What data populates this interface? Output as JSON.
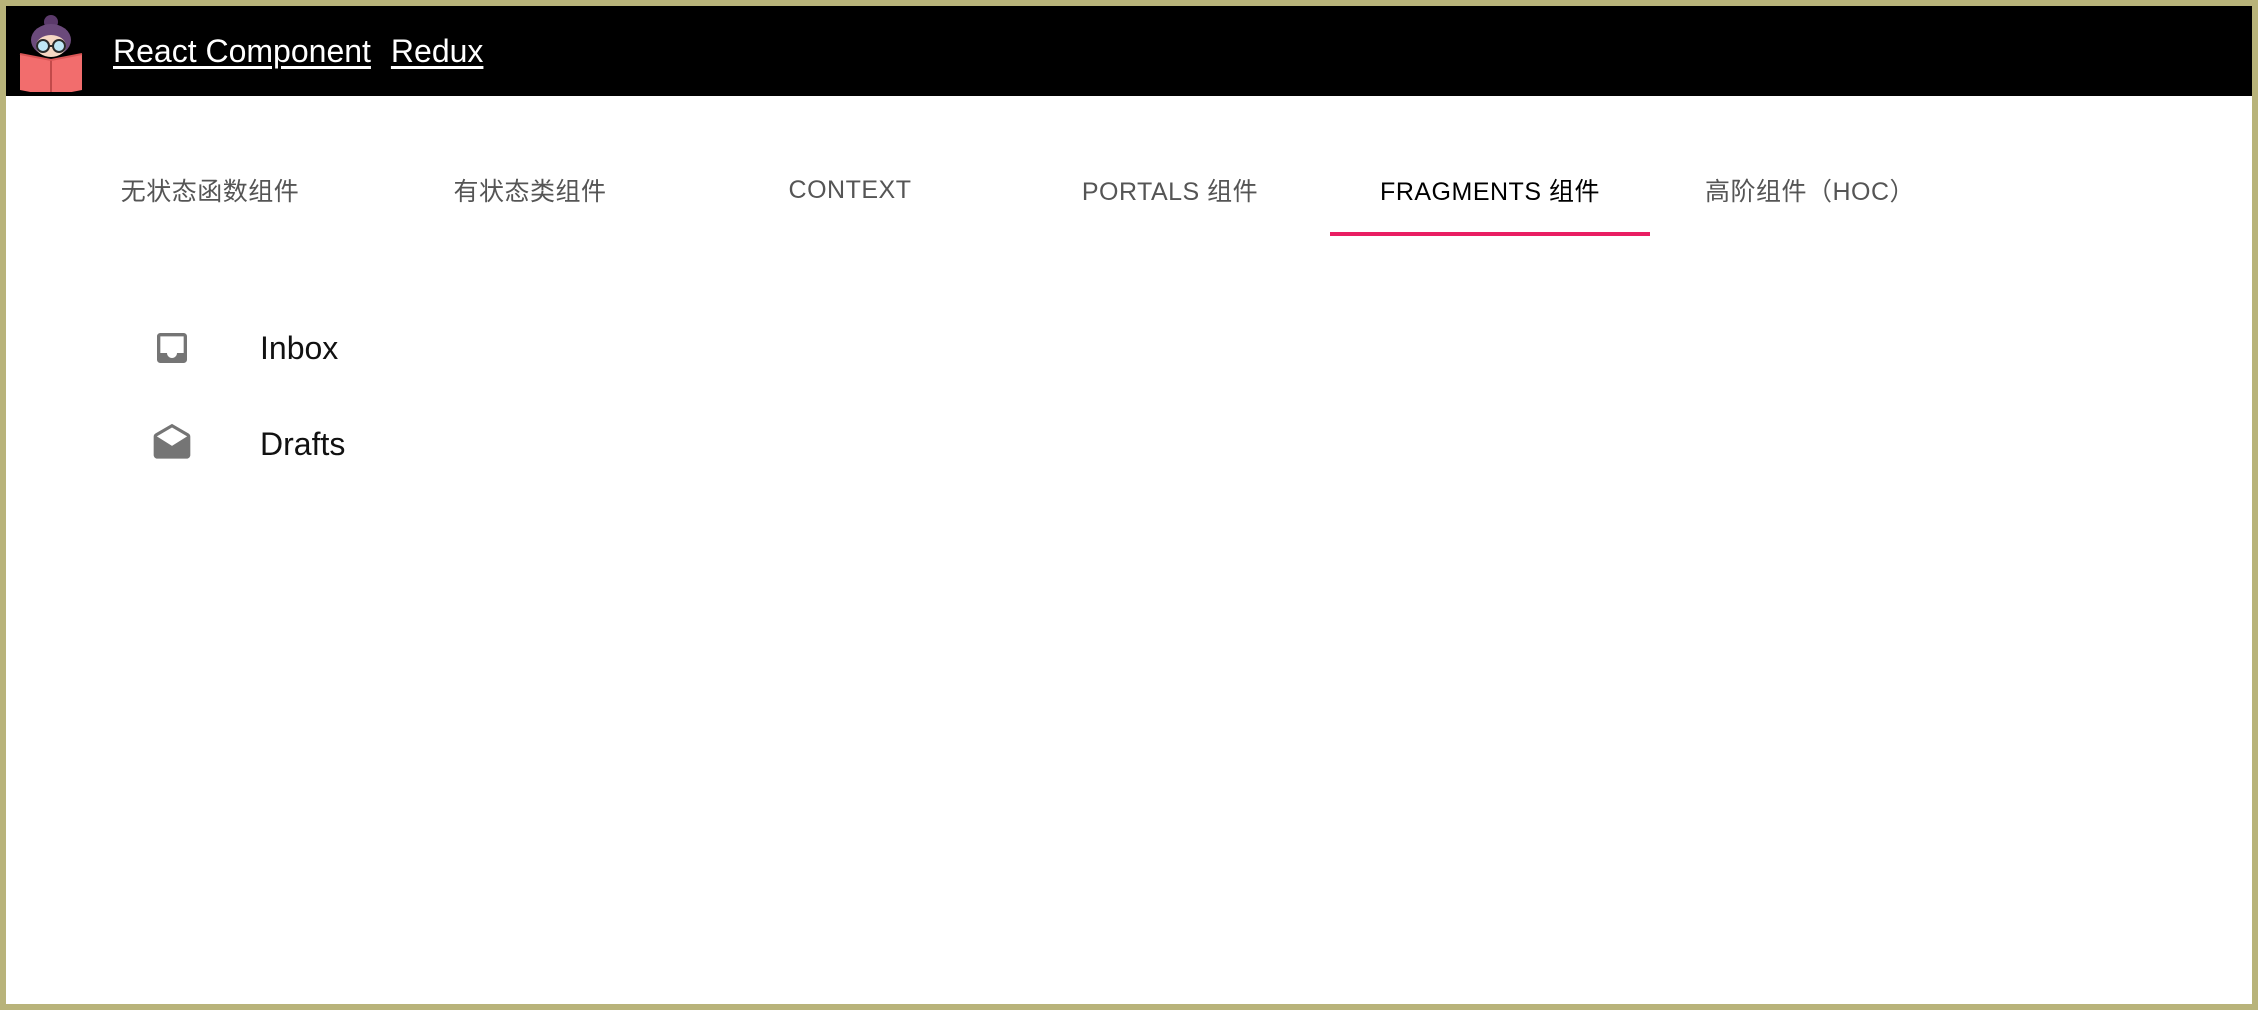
{
  "header": {
    "links": [
      "React Component",
      "Redux"
    ],
    "background": "#000000",
    "logo_icon": "reading-girl-logo-icon"
  },
  "tabs": {
    "items": [
      {
        "label": "无状态函数组件",
        "active": false
      },
      {
        "label": "有状态类组件",
        "active": false
      },
      {
        "label": "CONTEXT",
        "active": false
      },
      {
        "label": "PORTALS 组件",
        "active": false
      },
      {
        "label": "FRAGMENTS 组件",
        "active": true
      },
      {
        "label": "高阶组件（HOC）",
        "active": false
      }
    ],
    "indicator_color": "#e91e63"
  },
  "list": {
    "items": [
      {
        "label": "Inbox",
        "icon": "inbox-icon"
      },
      {
        "label": "Drafts",
        "icon": "drafts-icon"
      }
    ],
    "icon_color": "#757575"
  },
  "frame_color": "#b8b37a"
}
